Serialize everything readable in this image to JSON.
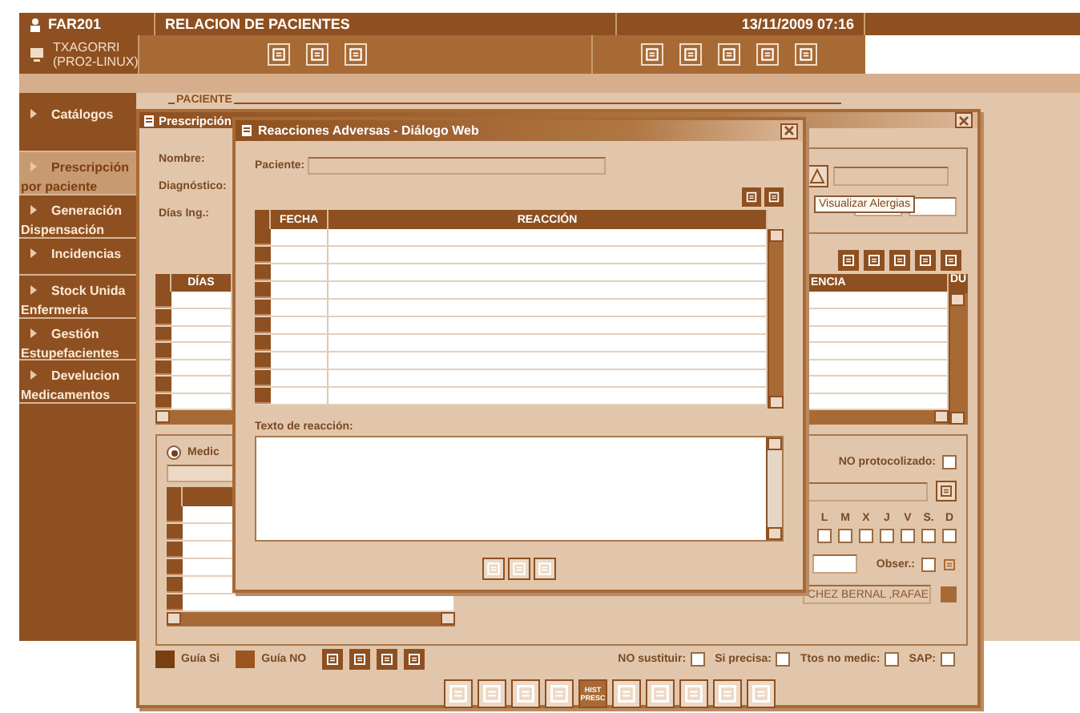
{
  "header": {
    "app_code": "FAR201",
    "title": "RELACION DE PACIENTES",
    "datetime": "13/11/2009 07:16",
    "user": "TXAGORRI",
    "server": "(PRO2-LINUX)"
  },
  "sidebar": {
    "items": [
      {
        "lines": [
          "Catálogos"
        ],
        "selected": false
      },
      {
        "lines": [
          "Prescripción",
          "por paciente"
        ],
        "selected": true
      },
      {
        "lines": [
          "Generación",
          "Dispensación"
        ],
        "selected": false
      },
      {
        "lines": [
          "Incidencias"
        ],
        "selected": false
      },
      {
        "lines": [
          "Stock Unida",
          "Enfermeria"
        ],
        "selected": false
      },
      {
        "lines": [
          "Gestión",
          "Estupefacientes"
        ],
        "selected": false
      },
      {
        "lines": [
          "Develucion",
          "Medicamentos"
        ],
        "selected": false
      }
    ]
  },
  "background_page": {
    "section_title": "PACIENTE"
  },
  "prescription_window": {
    "title": "Prescripción",
    "labels": [
      "Nombre:",
      "Diagnóstico:",
      "Días Ing.:"
    ],
    "grid": {
      "columns": [
        "DÍAS",
        "ENCIA",
        "DU"
      ]
    },
    "order_panel": {
      "radio": {
        "label": "Medic",
        "selected": true
      },
      "no_protocolizado": {
        "label": "NO protocolizado:",
        "checked": false
      },
      "days": [
        {
          "label": "L",
          "checked": false
        },
        {
          "label": "M",
          "checked": false
        },
        {
          "label": "X",
          "checked": false
        },
        {
          "label": "J",
          "checked": false
        },
        {
          "label": "V",
          "checked": false
        },
        {
          "label": "S.",
          "checked": false
        },
        {
          "label": "D",
          "checked": false
        }
      ],
      "obser": {
        "label": "Obser.:",
        "checked": false
      },
      "doctor": "CHEZ BERNAL ,RAFAE",
      "flags": [
        {
          "label": "NO sustituir:",
          "checked": false
        },
        {
          "label": "Si precisa:",
          "checked": false
        },
        {
          "label": "Ttos no medic:",
          "checked": false
        },
        {
          "label": "SAP:",
          "checked": false
        }
      ]
    },
    "legend": [
      {
        "label": "Guía Si",
        "color": "#7a3f10"
      },
      {
        "label": "Guía NO",
        "color": "#9a5520"
      }
    ],
    "hist_button": "HIST PRESC"
  },
  "dialog": {
    "title": "Reacciones Adversas - Diálogo Web",
    "patient_label": "Paciente:",
    "columns": [
      "FECHA",
      "REACCIÓN"
    ],
    "text_label": "Texto de reacción:"
  },
  "tooltip": "Visualizar Alergias"
}
